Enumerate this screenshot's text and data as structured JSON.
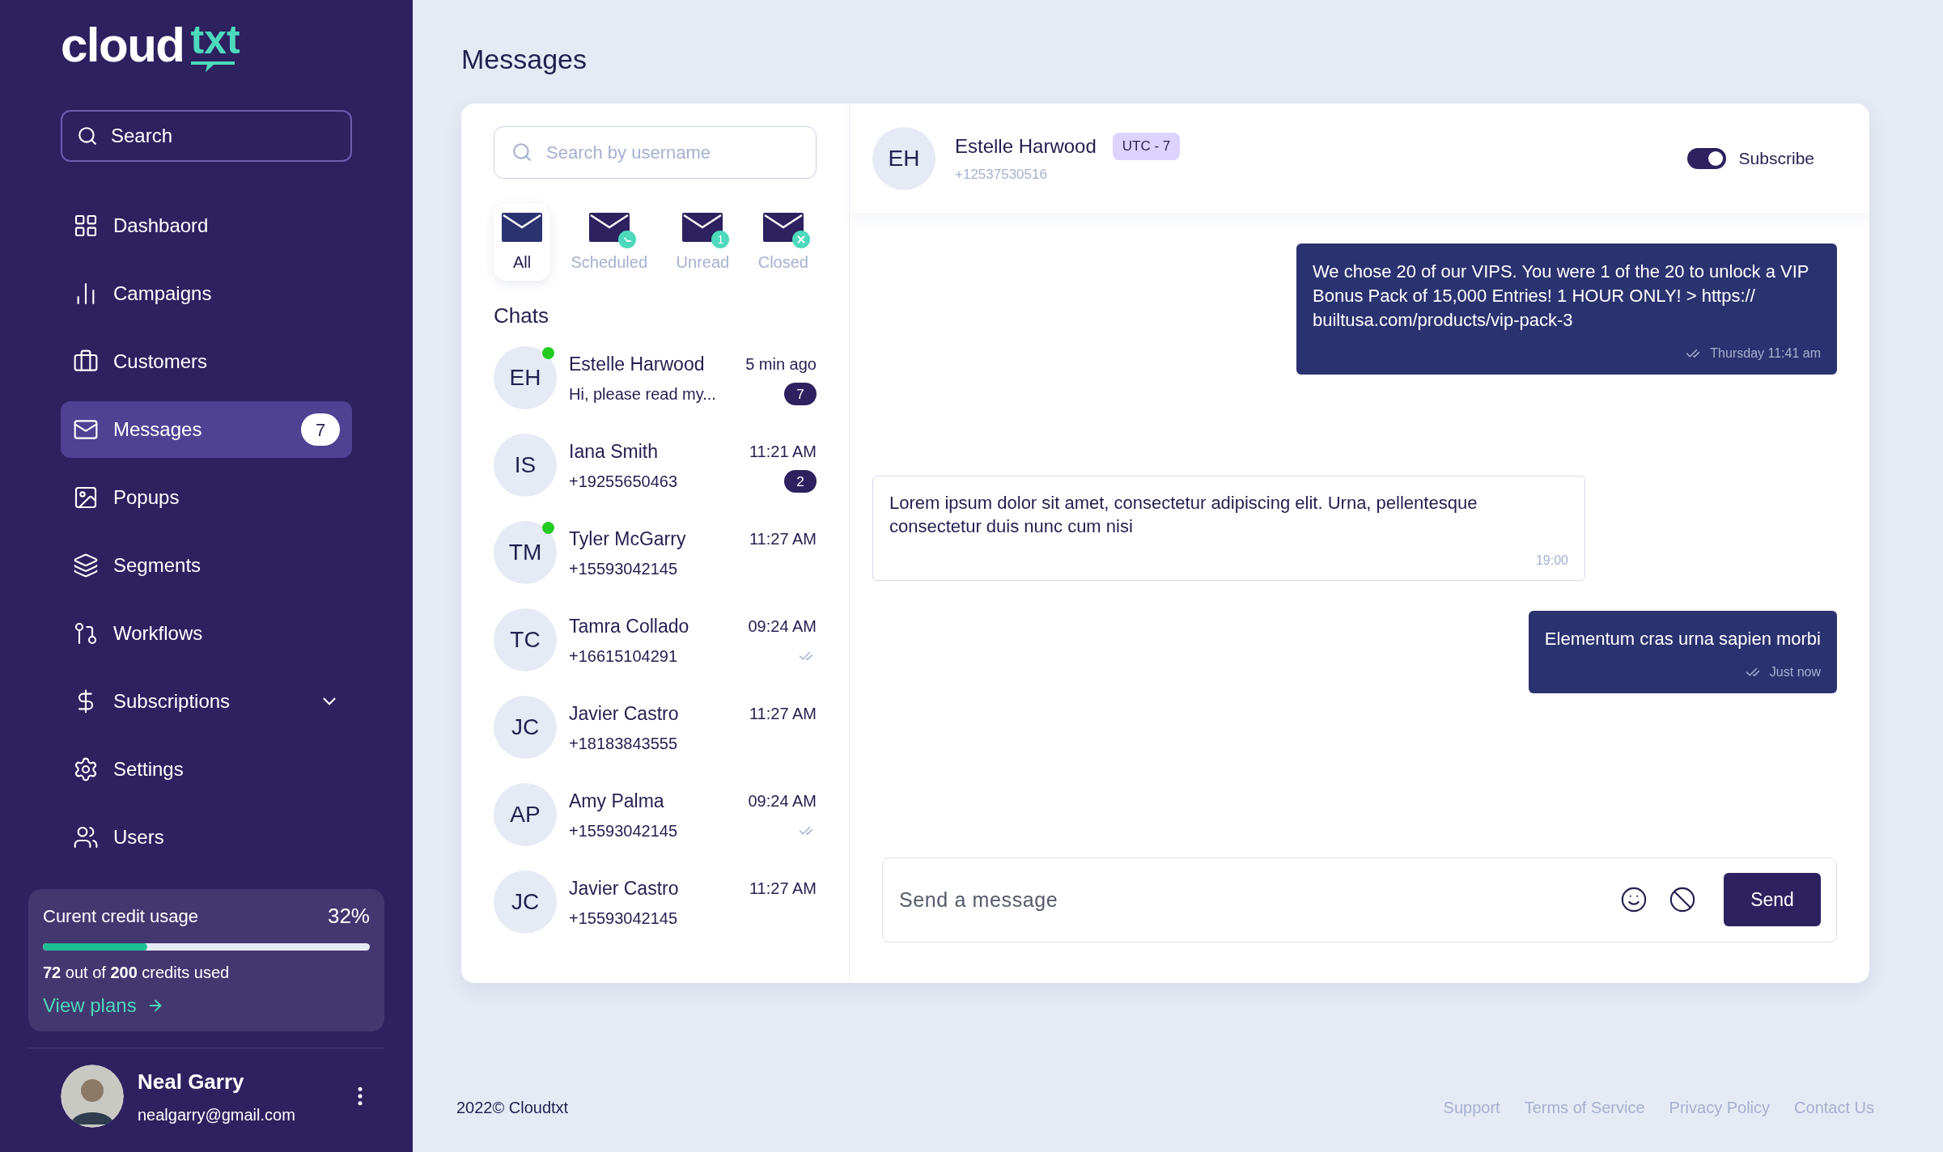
{
  "logo": {
    "main": "cloud",
    "accent": "txt"
  },
  "sidebar": {
    "search": {
      "placeholder": "Search"
    },
    "nav": [
      {
        "label": "Dashbaord",
        "selected": false
      },
      {
        "label": "Campaigns",
        "selected": false
      },
      {
        "label": "Customers",
        "selected": false
      },
      {
        "label": "Messages",
        "selected": true,
        "badge": "7"
      },
      {
        "label": "Popups",
        "selected": false
      },
      {
        "label": "Segments",
        "selected": false
      },
      {
        "label": "Workflows",
        "selected": false
      },
      {
        "label": "Subscriptions",
        "selected": false,
        "expanded": false
      },
      {
        "label": "Settings",
        "selected": false
      },
      {
        "label": "Users",
        "selected": false
      }
    ],
    "credit": {
      "title": "Curent credit usage",
      "percent": "32%",
      "level": 0.32,
      "summary": "**72** out of **200** credits used",
      "link": "View plans"
    },
    "user": {
      "name": "Neal Garry",
      "email": "nealgarry@gmail.com"
    }
  },
  "page_title": "Messages",
  "chat_search": {
    "placeholder": "Search by username"
  },
  "filters": [
    {
      "label": "All",
      "kind": "plain",
      "selected": true
    },
    {
      "label": "Scheduled",
      "kind": "clock",
      "selected": false
    },
    {
      "label": "Unread",
      "kind": "count",
      "count": "1",
      "selected": false
    },
    {
      "label": "Closed",
      "kind": "closed",
      "selected": false
    }
  ],
  "chats_heading": "Chats",
  "chats": [
    {
      "initials": "EH",
      "name": "Estelle Harwood",
      "detail": "Hi, please read my...",
      "time": "5 min ago",
      "unread": "7",
      "online": true,
      "read": false
    },
    {
      "initials": "IS",
      "name": "Iana Smith",
      "detail": "+19255650463",
      "time": "11:21 AM",
      "unread": "2",
      "online": false,
      "read": false
    },
    {
      "initials": "TM",
      "name": "Tyler McGarry",
      "detail": "+15593042145",
      "time": "11:27 AM",
      "online": true,
      "read": false
    },
    {
      "initials": "TC",
      "name": "Tamra Collado",
      "detail": "+16615104291",
      "time": "09:24 AM",
      "online": false,
      "read": true
    },
    {
      "initials": "JC",
      "name": "Javier Castro",
      "detail": "+18183843555",
      "time": "11:27 AM",
      "online": false,
      "read": false
    },
    {
      "initials": "AP",
      "name": "Amy Palma",
      "detail": "+15593042145",
      "time": "09:24 AM",
      "online": false,
      "read": true
    },
    {
      "initials": "JC",
      "name": "Javier Castro",
      "detail": "+15593042145",
      "time": "11:27 AM",
      "online": false,
      "read": false
    }
  ],
  "conversation": {
    "initials": "EH",
    "name": "Estelle Harwood",
    "timezone": "UTC - 7",
    "phone": "+12537530516",
    "subscribe": {
      "label": "Subscribe",
      "on": true
    },
    "messages": [
      {
        "kind": "outgoing",
        "text": "We chose 20 of our VIPS. You were 1 of the 20 to unlock a VIP Bonus Pack of 15,000 Entries! 1 HOUR ONLY! > https:// builtusa.com/products/vip-pack-3",
        "time": "Thursday 11:41 am",
        "read": true
      },
      {
        "kind": "incoming",
        "text": "Lorem ipsum dolor sit amet, consectetur adipiscing elit. Urna, pellentesque consectetur duis nunc cum nisi",
        "time": "19:00"
      },
      {
        "kind": "outgoing",
        "text": "Elementum cras urna sapien morbi",
        "time": "Just now",
        "read": true
      }
    ],
    "composer": {
      "placeholder": "Send a message",
      "button": "Send"
    }
  },
  "footer": {
    "copyright": "2022© Cloudtxt",
    "links": [
      "Support",
      "Terms of Service",
      "Privacy Policy",
      "Contact Us"
    ]
  }
}
